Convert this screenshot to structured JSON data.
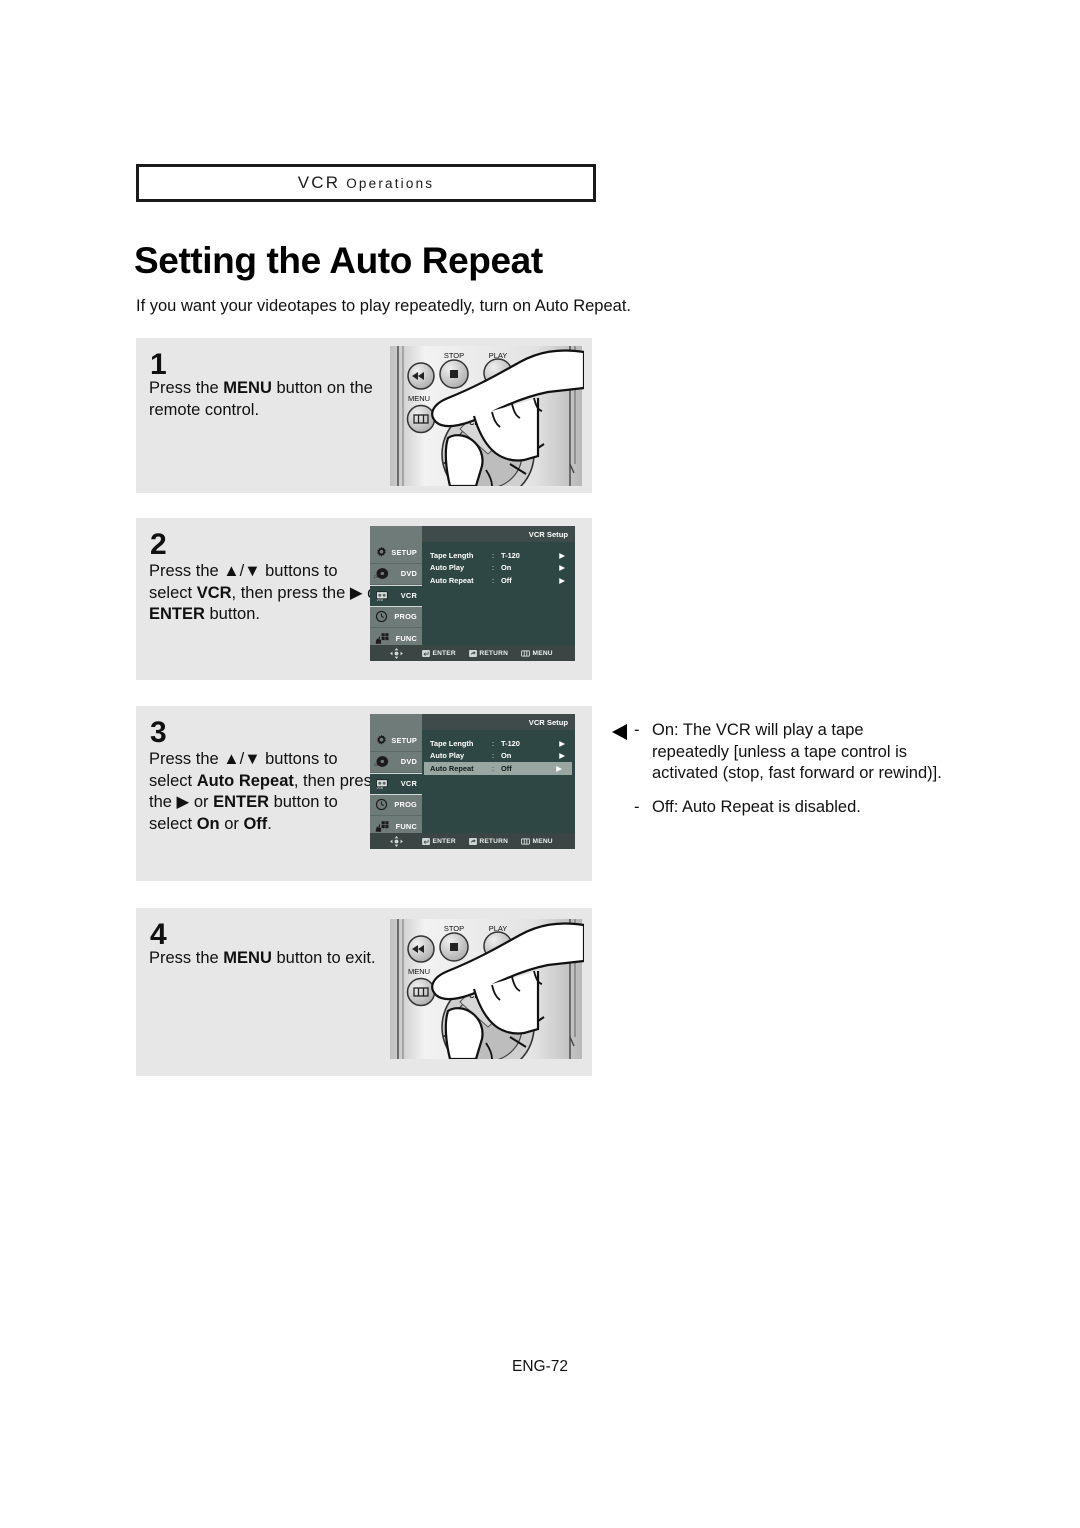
{
  "header": {
    "chapter_main": "VCR",
    "chapter_rest": "Operations"
  },
  "title": "Setting the Auto Repeat",
  "intro": "If you want your videotapes to play repeatedly, turn on Auto Repeat.",
  "steps": [
    {
      "number": "1",
      "text_parts": [
        "Press the ",
        "MENU",
        " button on the remote control."
      ],
      "figure": "remote-control"
    },
    {
      "number": "2",
      "text_parts": [
        "Press the ",
        "▲/▼",
        " buttons to select ",
        "VCR",
        ", then press the ",
        "▶",
        " or ",
        "ENTER",
        " button."
      ],
      "figure": "osd-menu"
    },
    {
      "number": "3",
      "text_parts": [
        "Press the ",
        "▲/▼",
        " buttons to select ",
        "Auto Repeat",
        ", then press the ",
        "▶",
        " or ",
        "ENTER",
        " button to select ",
        "On",
        " or ",
        "Off",
        "."
      ],
      "figure": "osd-menu"
    },
    {
      "number": "4",
      "text_parts": [
        "Press the ",
        "MENU",
        " button to exit."
      ],
      "figure": "remote-control"
    }
  ],
  "osd": {
    "title": "VCR Setup",
    "tabs": [
      {
        "label": "SETUP",
        "icon": "gear-icon",
        "active": false
      },
      {
        "label": "DVD",
        "icon": "disc-icon",
        "active": false
      },
      {
        "label": "VCR",
        "icon": "cassette-icon",
        "active": true
      },
      {
        "label": "PROG",
        "icon": "clock-icon",
        "active": false
      },
      {
        "label": "FUNC",
        "icon": "hand-buttons-icon",
        "active": false
      }
    ],
    "rows": [
      {
        "label": "Tape Length",
        "colon": ":",
        "value": "T-120",
        "caret": "▶"
      },
      {
        "label": "Auto Play",
        "colon": ":",
        "value": "On",
        "caret": "▶"
      },
      {
        "label": "Auto Repeat",
        "colon": ":",
        "value": "Off",
        "caret": "▶"
      }
    ],
    "selected_row_step2": -1,
    "selected_row_step3": 2,
    "hints": [
      {
        "label": "ENTER",
        "icon": "enter-key-icon"
      },
      {
        "label": "RETURN",
        "icon": "return-key-icon"
      },
      {
        "label": "MENU",
        "icon": "menu-key-icon"
      }
    ],
    "dpad_icon": "dpad-icon"
  },
  "remote": {
    "label_stop": "STOP",
    "label_play": "PLAY",
    "label_menu": "MENU",
    "label_dial": "CH ▲ TRK",
    "rewind_icon": "rewind-icon",
    "stop_icon": "stop-icon",
    "play_icon": "play-icon",
    "menu_icon": "menu-icon",
    "left_icon": "left-arrow-icon",
    "hand_icon": "hand-pressing-icon"
  },
  "annotation": {
    "arrow_icon": "left-triangle-arrow-icon",
    "items": [
      {
        "dash": "-",
        "text": "On: The VCR will play a tape repeatedly [unless a tape control is activated (stop, fast forward or rewind)]."
      },
      {
        "dash": "-",
        "text": "Off: Auto Repeat is disabled."
      }
    ]
  },
  "footer": "ENG-72",
  "colors": {
    "panel_bg": "#e7e7e7",
    "osd_bg": "#2f4744",
    "osd_sidebar": "#6f7b79",
    "osd_selected": "#9aa6a2"
  }
}
